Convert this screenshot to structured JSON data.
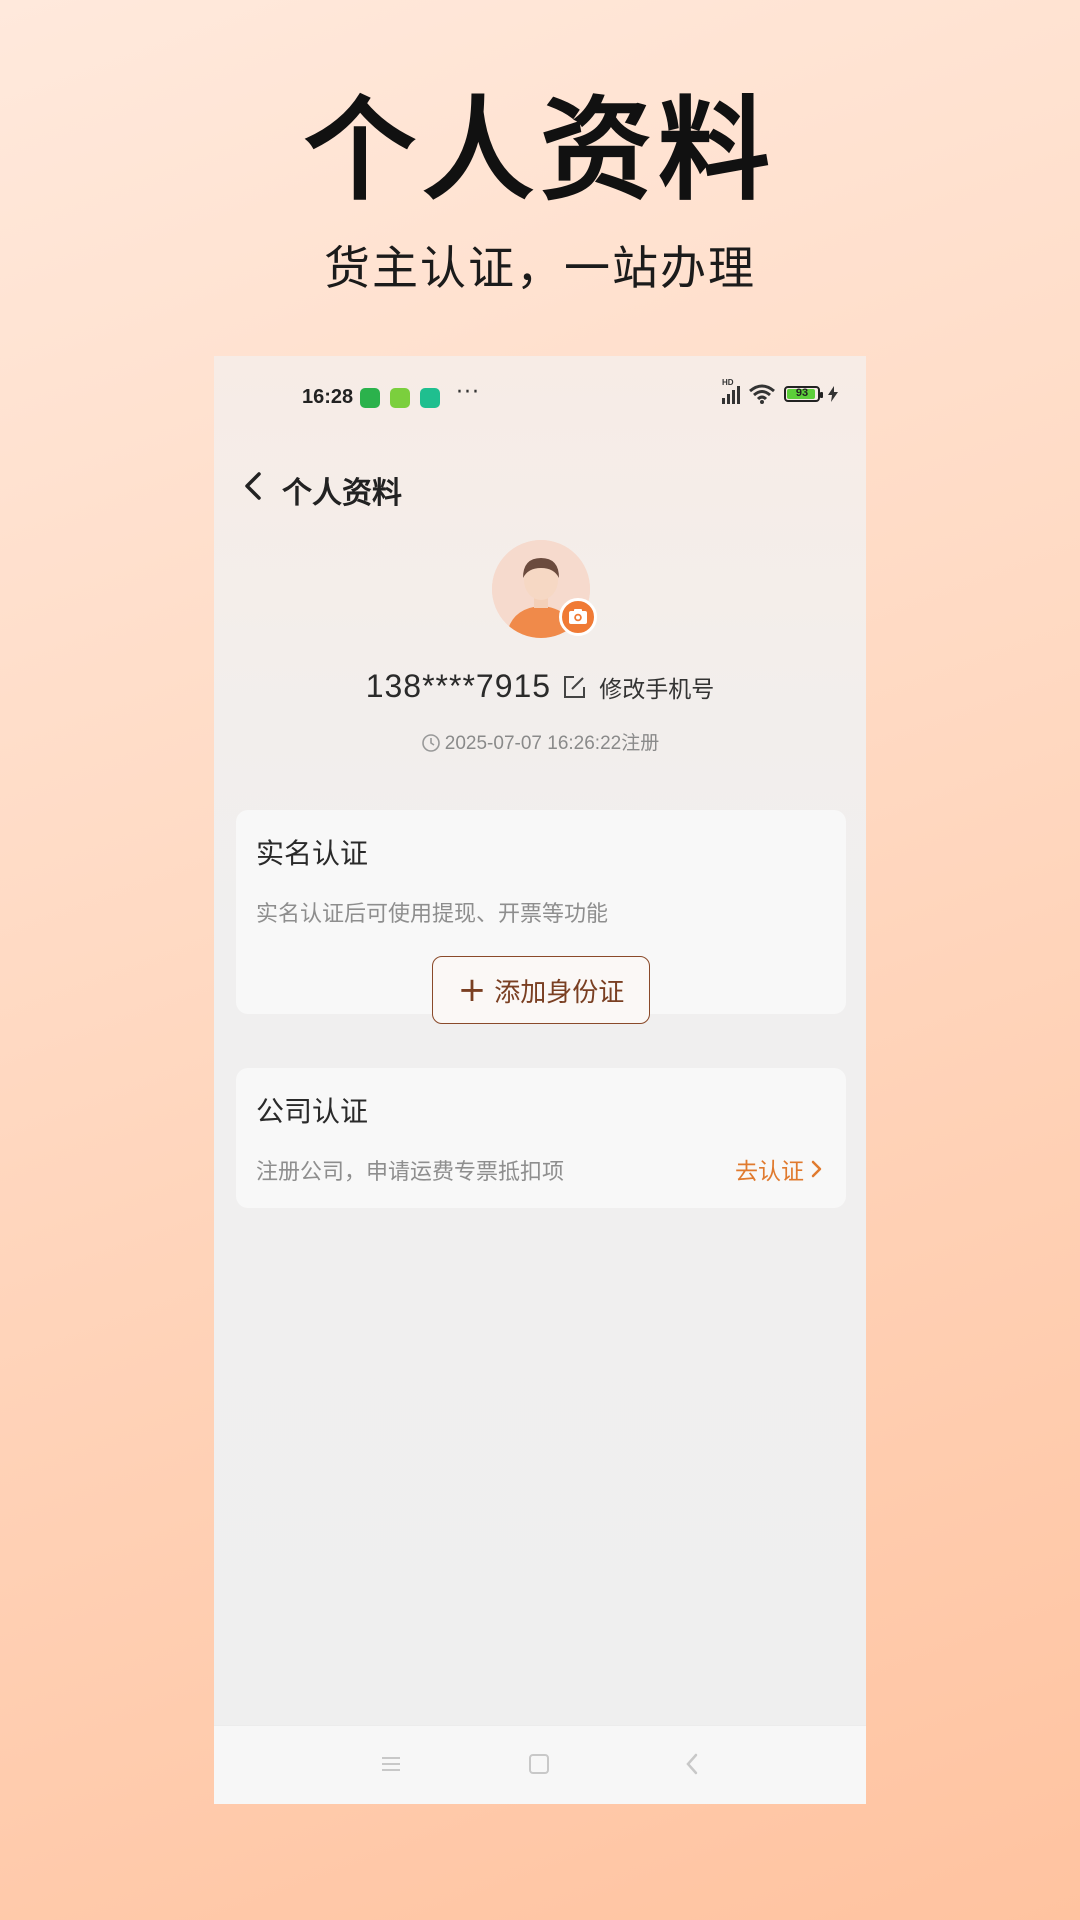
{
  "promo": {
    "title": "个人资料",
    "subtitle": "货主认证，一站办理"
  },
  "status_bar": {
    "time": "16:28",
    "battery": "93",
    "network_label": "HD"
  },
  "header": {
    "title": "个人资料"
  },
  "profile": {
    "phone": "138****7915",
    "modify_label": "修改手机号",
    "registered": "2025-07-07 16:26:22注册"
  },
  "real_name_card": {
    "title": "实名认证",
    "description": "实名认证后可使用提现、开票等功能",
    "button_label": "添加身份证"
  },
  "company_card": {
    "title": "公司认证",
    "description": "注册公司，申请运费专票抵扣项",
    "link_label": "去认证"
  },
  "colors": {
    "accent": "#f07a35",
    "link": "#e07a2e",
    "button_border": "#8a4a2a"
  }
}
